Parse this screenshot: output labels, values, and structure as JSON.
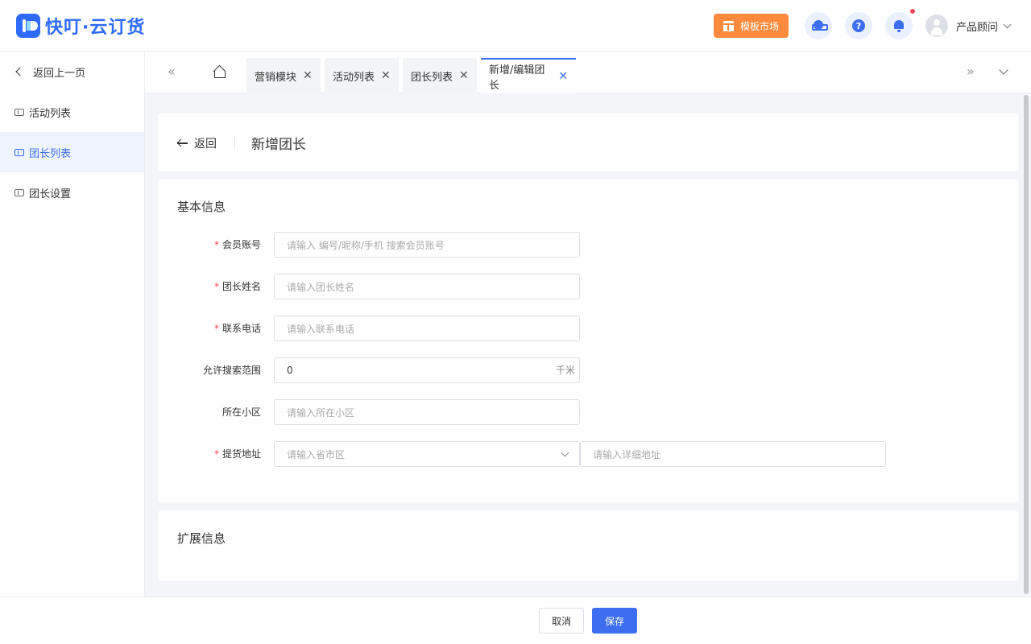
{
  "header": {
    "logo_text": "快叮·云订货",
    "market_button": "模板市场",
    "icons": [
      "customer-service-icon",
      "help-icon",
      "bell-icon"
    ],
    "user_name": "产品顾问",
    "accent": "#3d6ef0",
    "market_color": "#ff8a3d"
  },
  "sidebar": {
    "back": "返回上一页",
    "items": [
      {
        "label": "活动列表",
        "active": false
      },
      {
        "label": "团长列表",
        "active": true
      },
      {
        "label": "团长设置",
        "active": false
      }
    ]
  },
  "tabs": [
    {
      "label": "营销模块",
      "active": false
    },
    {
      "label": "活动列表",
      "active": false
    },
    {
      "label": "团长列表",
      "active": false
    },
    {
      "label": "新增/编辑团长",
      "active": true
    }
  ],
  "page": {
    "back_label": "返回",
    "title": "新增团长"
  },
  "basic": {
    "section_title": "基本信息",
    "fields": [
      {
        "label": "会员账号",
        "required": true,
        "placeholder": "请输入 编号/昵称/手机 搜索会员账号",
        "value": ""
      },
      {
        "label": "团长姓名",
        "required": true,
        "placeholder": "请输入团长姓名",
        "value": ""
      },
      {
        "label": "联系电话",
        "required": true,
        "placeholder": "请输入联系电话",
        "value": ""
      },
      {
        "label": "允许搜索范围",
        "required": false,
        "placeholder": "",
        "value": "0",
        "suffix": "千米"
      },
      {
        "label": "所在小区",
        "required": false,
        "placeholder": "请输入所在小区",
        "value": ""
      },
      {
        "label": "提货地址",
        "required": true,
        "placeholder": "请输入省市区",
        "value": "",
        "detail_placeholder": "请输入详细地址"
      }
    ]
  },
  "extended": {
    "section_title": "扩展信息"
  },
  "footer": {
    "cancel": "取消",
    "save": "保存"
  }
}
